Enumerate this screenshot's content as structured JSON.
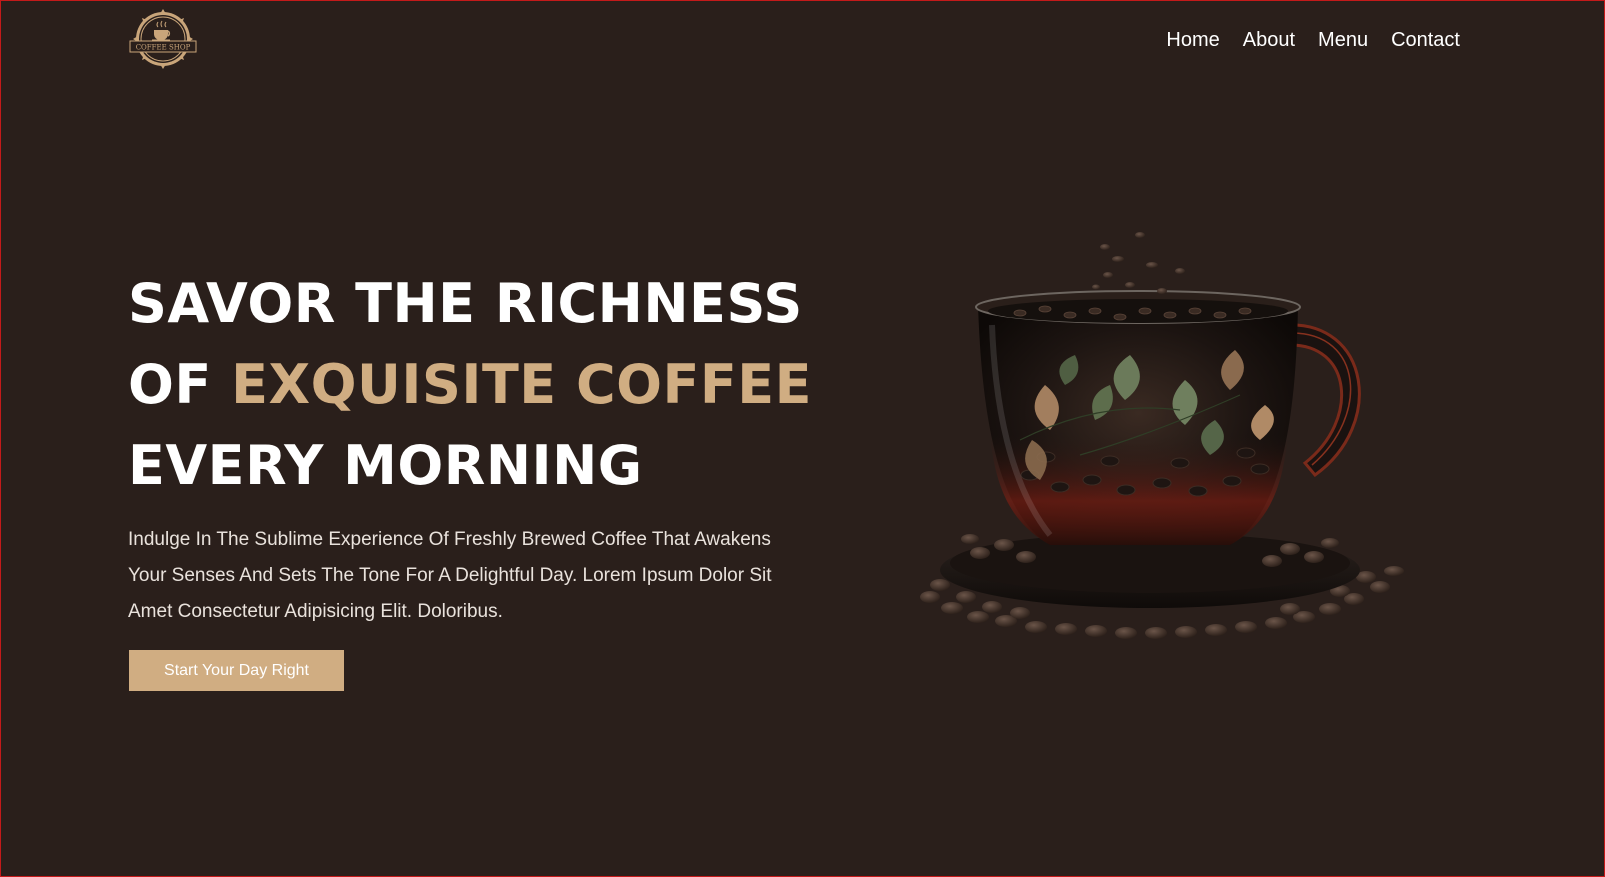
{
  "header": {
    "logo_text": "COFFEE SHOP",
    "nav": [
      "Home",
      "About",
      "Menu",
      "Contact"
    ]
  },
  "hero": {
    "title_line1": "SAVOR THE RICHNESS",
    "title_line2_prefix": "OF ",
    "title_line2_accent": "EXQUISITE COFFEE",
    "title_line3": "EVERY MORNING",
    "description": "Indulge In The Sublime Experience Of Freshly Brewed Coffee That Awakens Your Senses And Sets The Tone For A Delightful Day. Lorem Ipsum Dolor Sit Amet Consectetur Adipisicing Elit. Doloribus.",
    "cta_label": "Start Your Day Right",
    "image_icon": "coffee-cup-with-beans-icon"
  },
  "colors": {
    "background": "#2a1f1b",
    "accent": "#d0ad82",
    "text": "#ffffff",
    "frame_border": "#c41a1a"
  }
}
